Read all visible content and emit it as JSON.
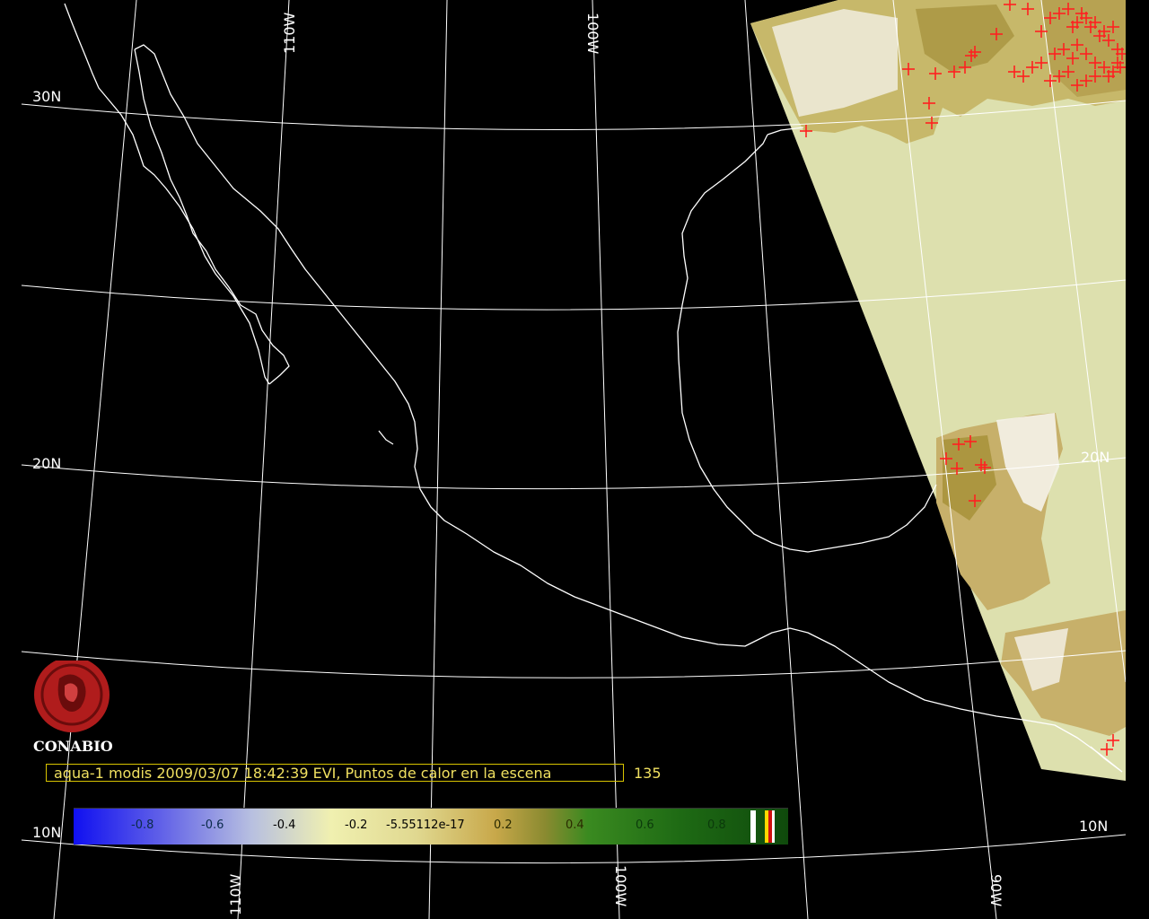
{
  "map": {
    "grid_labels": {
      "lon_110w_top": "110W",
      "lon_100w_top": "100W",
      "lon_110w_bottom": "110W",
      "lon_100w_bottom": "100W",
      "lon_90w_bottom": "90W",
      "lat_30n": "30N",
      "lat_20n_left": "20N",
      "lat_20n_right": "20N",
      "lat_10n_left": "10N",
      "lat_10n_right": "10N"
    },
    "colors": {
      "background": "#000000",
      "grid": "#ffffff",
      "coastline": "#ffffff",
      "swath": "#dde0ae",
      "hotspot": "#ff2020",
      "caption": "#f0e060"
    }
  },
  "caption": {
    "text": "aqua-1 modis 2009/03/07 18:42:39 EVI, Puntos de calor en la escena",
    "hotspot_count": "135"
  },
  "logo": {
    "name": "CONABIO"
  },
  "colorbar": {
    "ticks": [
      "-0.8",
      "-0.6",
      "-0.4",
      "-0.2",
      "-5.55112e-17",
      "0.2",
      "0.4",
      "0.6",
      "0.8"
    ]
  }
}
